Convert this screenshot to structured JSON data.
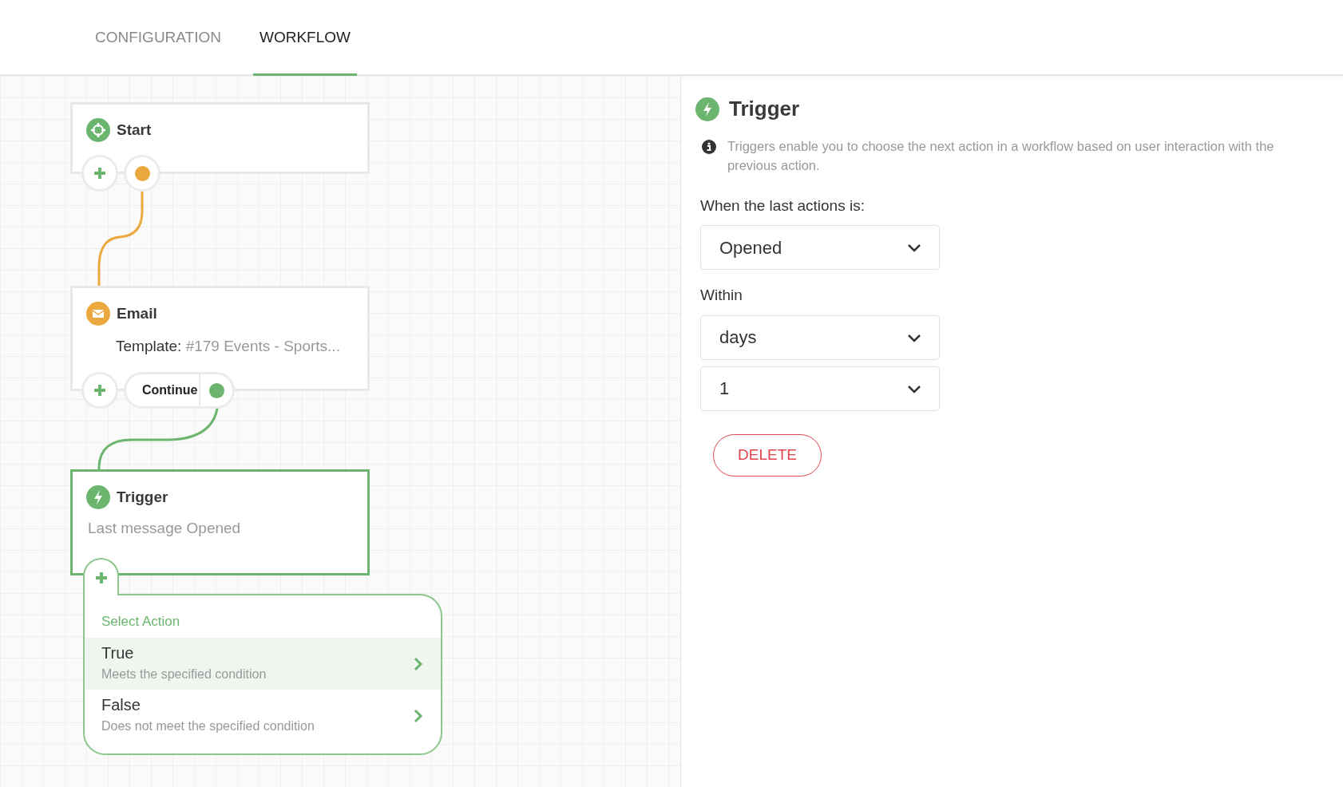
{
  "tabs": [
    {
      "label": "CONFIGURATION",
      "selected": false
    },
    {
      "label": "WORKFLOW",
      "selected": true
    }
  ],
  "nodes": [
    {
      "kind": "start",
      "title": "Start",
      "selected": false
    },
    {
      "kind": "email",
      "title": "Email",
      "template_label": "Template:",
      "template_value": "#179 Events - Sports...",
      "output_label": "Continue",
      "selected": false
    },
    {
      "kind": "trigger",
      "title": "Trigger",
      "summary": "Last message Opened",
      "selected": true
    }
  ],
  "action_menu": {
    "title": "Select Action",
    "options": [
      {
        "label": "True",
        "description": "Meets the specified condition",
        "selected": true
      },
      {
        "label": "False",
        "description": "Does not meet the specified condition",
        "selected": false
      }
    ]
  },
  "panel": {
    "title": "Trigger",
    "info": "Triggers enable you to choose the next action in a workflow based on user interaction with the previous action.",
    "fields": [
      {
        "label": "When the last actions is:",
        "value": "Opened"
      },
      {
        "label": "Within",
        "value": "days"
      },
      {
        "value": "1"
      }
    ],
    "delete_button": "DELETE"
  }
}
